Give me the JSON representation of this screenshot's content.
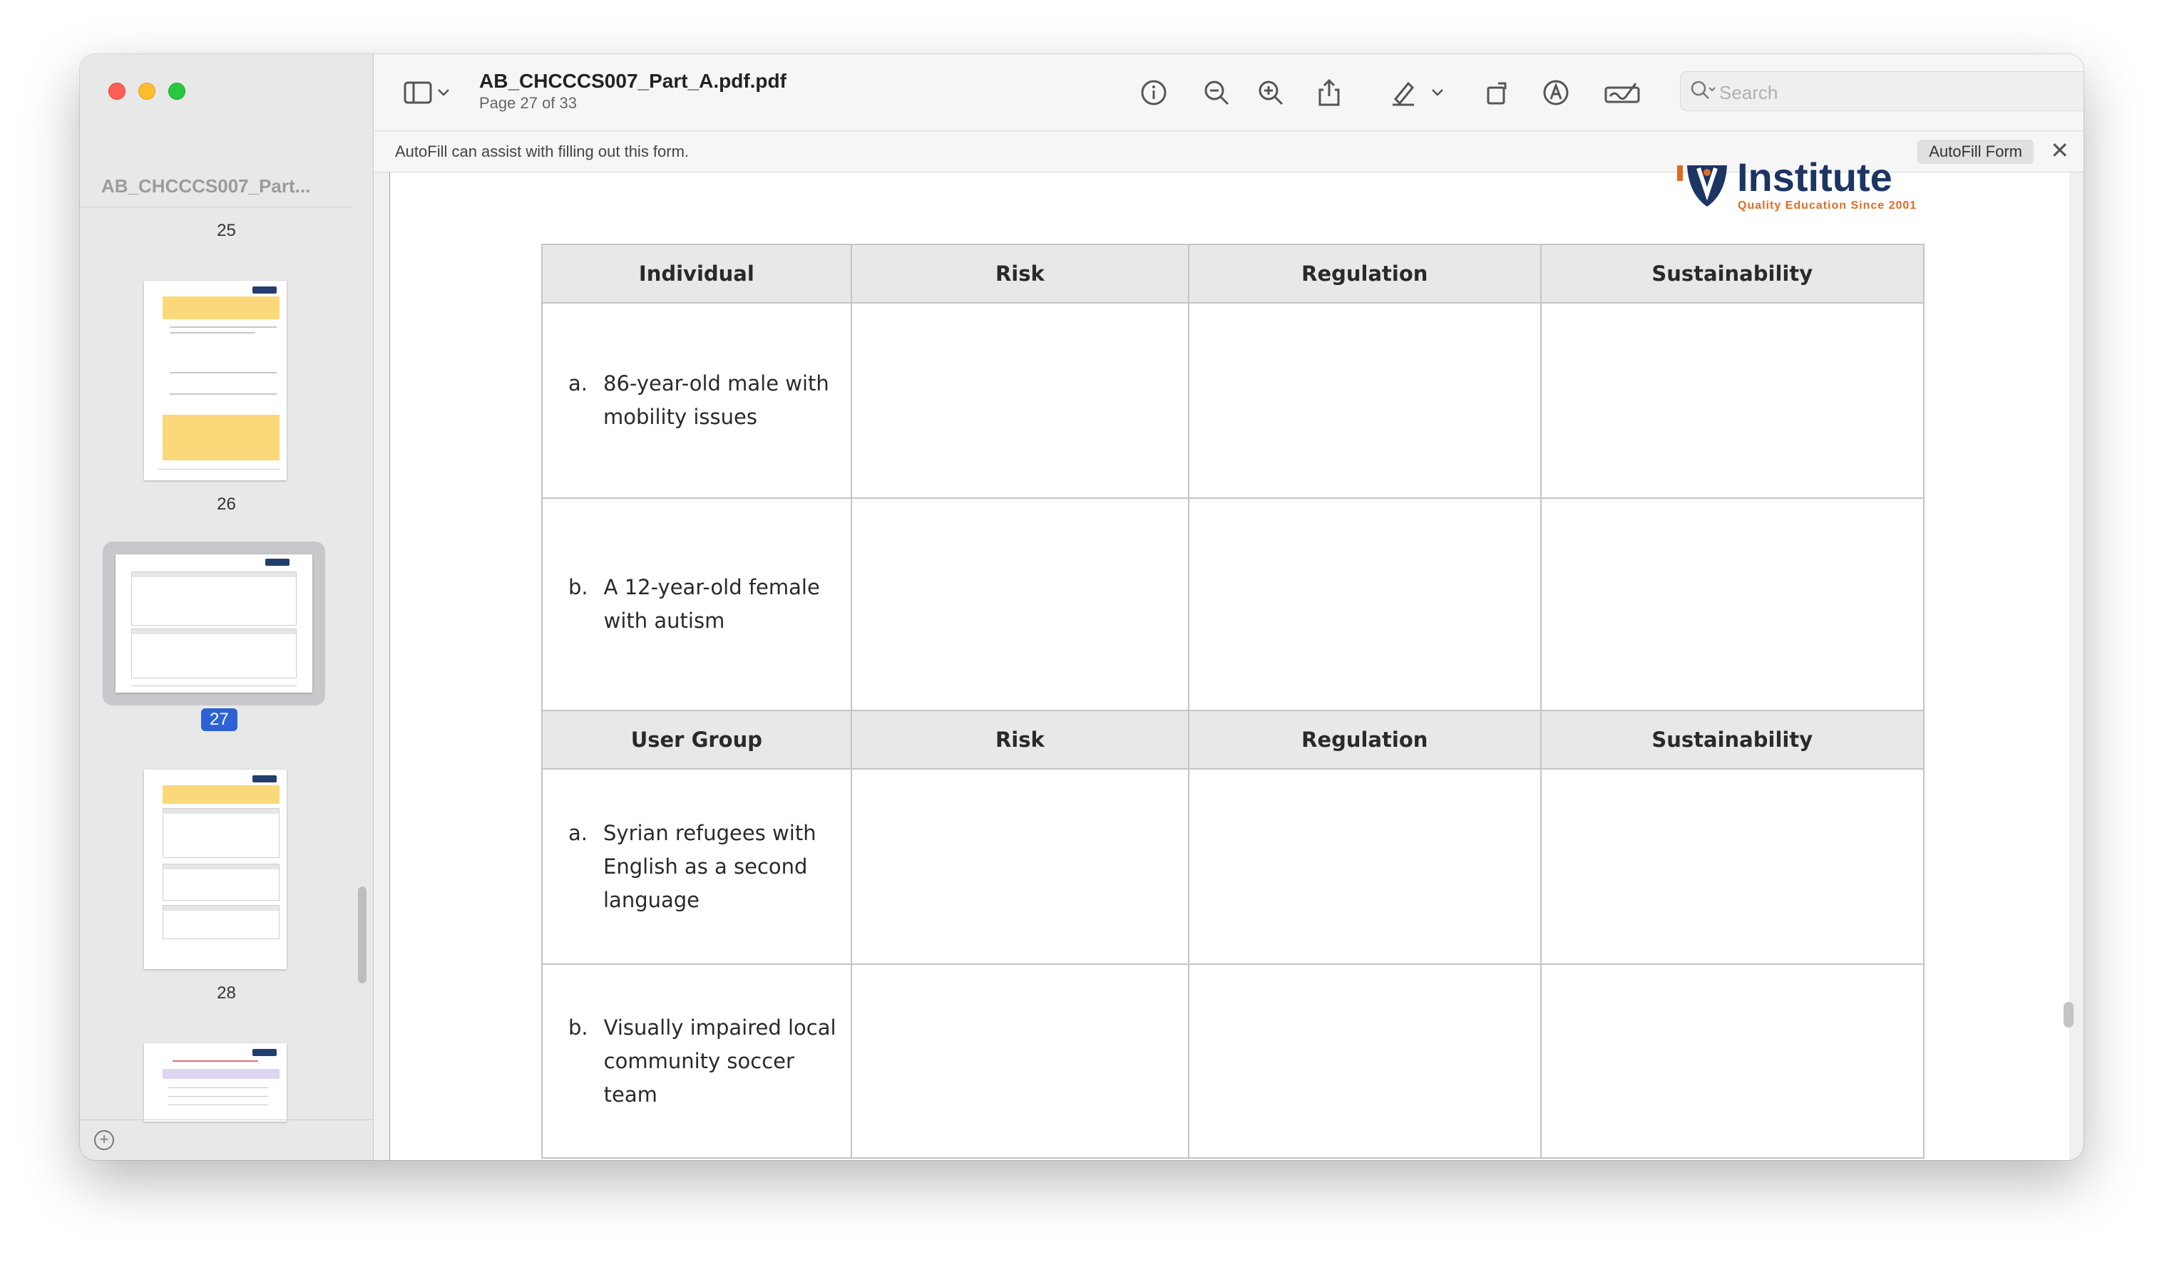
{
  "window": {
    "sidebar_title": "AB_CHCCCS007_Part...",
    "document_title": "AB_CHCCCS007_Part_A.pdf.pdf",
    "page_indicator": "Page 27 of 33"
  },
  "sidebar": {
    "pages": [
      {
        "number": "25"
      },
      {
        "number": "26"
      },
      {
        "number": "27",
        "selected": true
      },
      {
        "number": "28"
      }
    ]
  },
  "toolbar": {
    "icons": [
      "sidebar-toggle-icon",
      "chevron-down-icon",
      "info-icon",
      "zoom-out-icon",
      "zoom-in-icon",
      "share-icon",
      "markup-pen-icon",
      "chevron-down-icon",
      "rotate-icon",
      "annotate-icon",
      "sign-icon",
      "search-icon"
    ],
    "search_placeholder": "Search"
  },
  "autofill": {
    "message": "AutoFill can assist with filling out this form.",
    "button_label": "AutoFill Form"
  },
  "document": {
    "logo_text": "Institute",
    "logo_tagline": "Quality Education Since 2001",
    "table1": {
      "headers": [
        "Individual",
        "Risk",
        "Regulation",
        "Sustainability"
      ],
      "rows": [
        {
          "letter": "a.",
          "text": "86-year-old male with mobility issues"
        },
        {
          "letter": "b.",
          "text": "A 12-year-old female with autism"
        }
      ]
    },
    "table2": {
      "headers": [
        "User Group",
        "Risk",
        "Regulation",
        "Sustainability"
      ],
      "rows": [
        {
          "letter": "a.",
          "text": "Syrian refugees with English as a second language"
        },
        {
          "letter": "b.",
          "text": "Visually impaired local community soccer team"
        }
      ]
    }
  },
  "colors": {
    "accent_blue": "#2d62d4",
    "logo_navy": "#1d3563",
    "logo_orange": "#e26a23",
    "header_gray": "#e8e8e8"
  }
}
